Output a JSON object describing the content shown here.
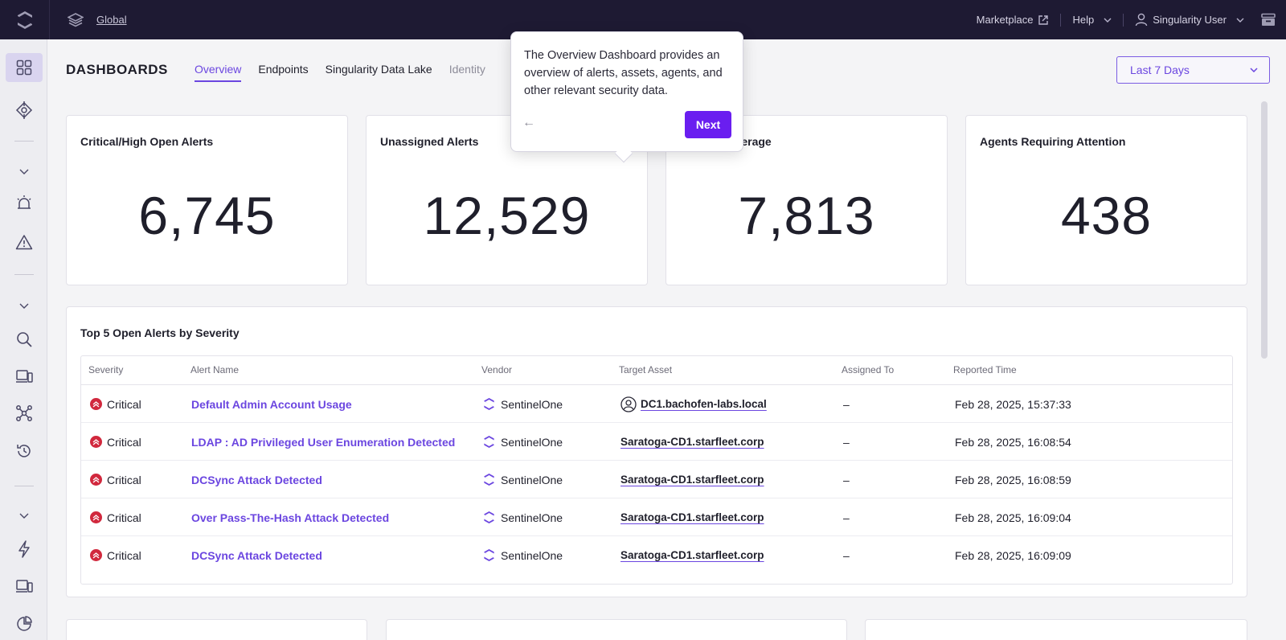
{
  "topbar": {
    "scope": "Global",
    "marketplace": "Marketplace",
    "help": "Help",
    "user": "Singularity User"
  },
  "header": {
    "title": "DASHBOARDS",
    "tabs": [
      {
        "label": "Overview"
      },
      {
        "label": "Endpoints"
      },
      {
        "label": "Singularity Data Lake"
      },
      {
        "label": "Identity"
      }
    ],
    "range": "Last 7 Days"
  },
  "cards": [
    {
      "title": "Critical/High Open Alerts",
      "value": "6,745"
    },
    {
      "title": "Unassigned Alerts",
      "value": "12,529"
    },
    {
      "title": "ing Coverage",
      "value": "7,813"
    },
    {
      "title": "Agents Requiring Attention",
      "value": "438"
    }
  ],
  "table": {
    "title": "Top 5 Open Alerts by Severity",
    "columns": [
      "Severity",
      "Alert Name",
      "Vendor",
      "Target Asset",
      "Assigned To",
      "Reported Time"
    ],
    "rows": [
      {
        "severity": "Critical",
        "name": "Default Admin Account Usage",
        "vendor": "SentinelOne",
        "asset": "DC1.bachofen-labs.local",
        "assigned": "–",
        "time": "Feb 28, 2025, 15:37:33"
      },
      {
        "severity": "Critical",
        "name": "LDAP : AD Privileged User Enumeration Detected",
        "vendor": "SentinelOne",
        "asset": "Saratoga-CD1.starfleet.corp",
        "assigned": "–",
        "time": "Feb 28, 2025, 16:08:54"
      },
      {
        "severity": "Critical",
        "name": "DCSync Attack Detected",
        "vendor": "SentinelOne",
        "asset": "Saratoga-CD1.starfleet.corp",
        "assigned": "–",
        "time": "Feb 28, 2025, 16:08:59"
      },
      {
        "severity": "Critical",
        "name": "Over Pass-The-Hash Attack Detected",
        "vendor": "SentinelOne",
        "asset": "Saratoga-CD1.starfleet.corp",
        "assigned": "–",
        "time": "Feb 28, 2025, 16:09:04"
      },
      {
        "severity": "Critical",
        "name": "DCSync Attack Detected",
        "vendor": "SentinelOne",
        "asset": "Saratoga-CD1.starfleet.corp",
        "assigned": "–",
        "time": "Feb 28, 2025, 16:09:09"
      }
    ]
  },
  "tooltip": {
    "text": "The Overview Dashboard provides an overview of alerts, assets, agents, and other relevant security data.",
    "back": "←",
    "next": "Next"
  },
  "colors": {
    "accent": "#6b46e0",
    "topbar": "#1e1a33",
    "critical": "#d1283d",
    "next_button": "#6a1ef0"
  }
}
